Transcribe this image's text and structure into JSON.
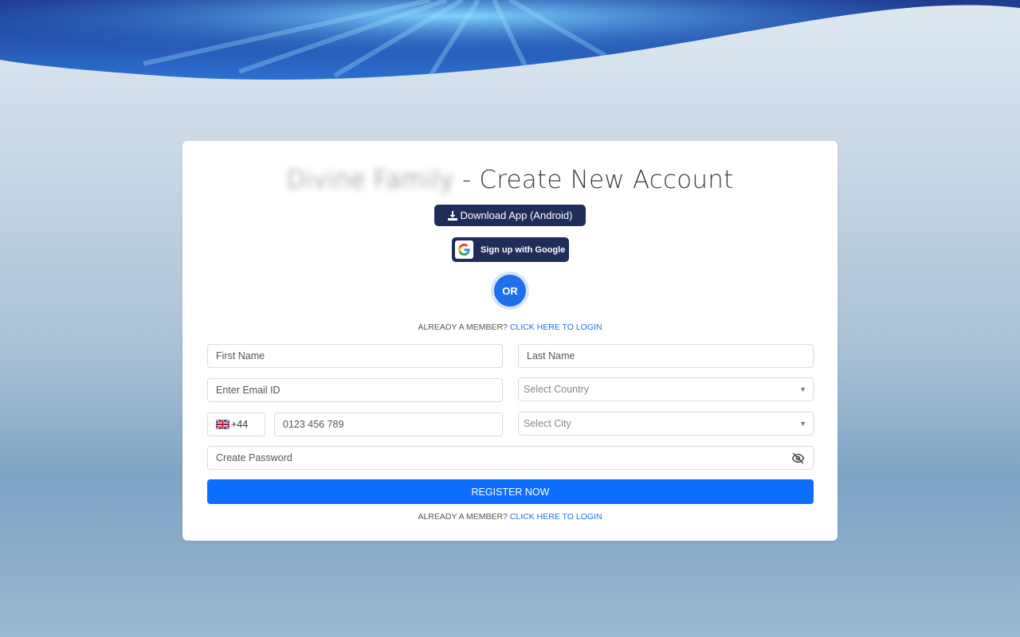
{
  "page": {
    "brand_name": "Divine Family",
    "title_suffix": " - Create New Account"
  },
  "buttons": {
    "download_app": "Download App (Android)",
    "google_signup": "Sign up with Google",
    "or": "OR",
    "register": "REGISTER NOW"
  },
  "member_prompt": {
    "text": "ALREADY A MEMBER?",
    "link": "CLICK HERE TO LOGIN"
  },
  "form": {
    "first_name_placeholder": "First Name",
    "last_name_placeholder": "Last Name",
    "email_placeholder": "Enter Email ID",
    "country_placeholder": "Select Country",
    "dial_code": "+44",
    "phone_placeholder": "0123 456 789",
    "city_placeholder": "Select City",
    "password_placeholder": "Create Password"
  },
  "colors": {
    "primary": "#0d6efd",
    "dark_button": "#1f2d5a",
    "link": "#1f6fea"
  },
  "icons": [
    "download-icon",
    "google-icon",
    "uk-flag-icon",
    "eye-slash-icon",
    "caret-down-icon"
  ]
}
